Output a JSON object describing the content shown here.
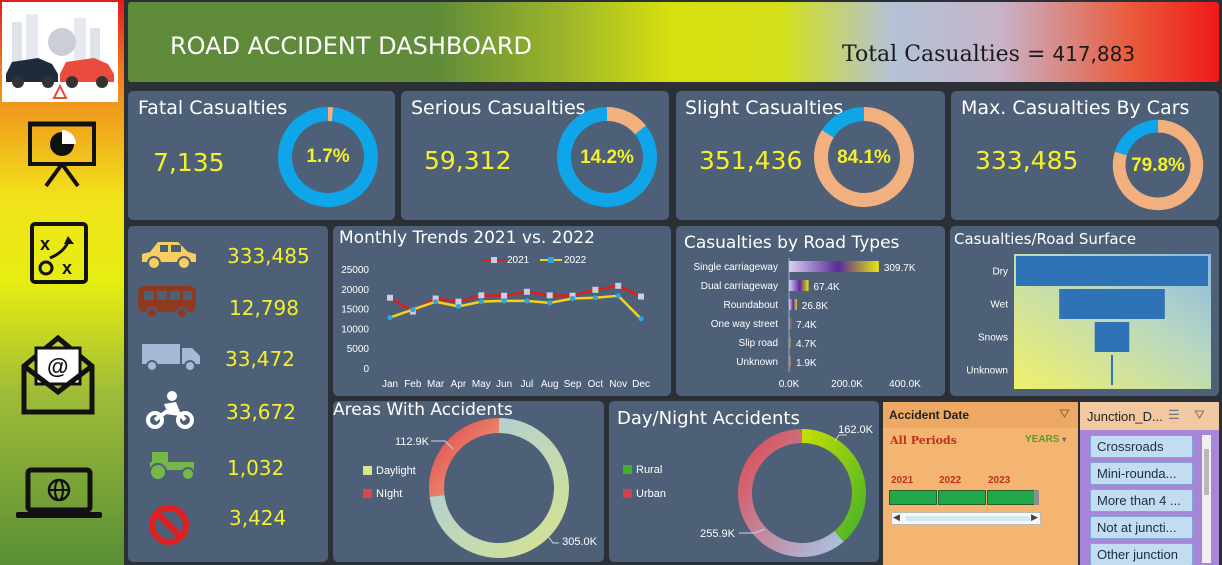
{
  "header": {
    "title": "ROAD ACCIDENT DASHBOARD",
    "total_label": "Total Casualties =",
    "total_value": "417,883"
  },
  "sidebar": {
    "icons": [
      "crash-logo-icon",
      "presentation-chart-icon",
      "strategy-board-icon",
      "email-icon",
      "laptop-globe-icon"
    ]
  },
  "kpis": [
    {
      "title": "Fatal Casualties",
      "value": "7,135",
      "pct_label": "1.7%",
      "pct": 0.017,
      "colors": [
        "#f3b07f",
        "#0fa5e9"
      ]
    },
    {
      "title": "Serious Casualties",
      "value": "59,312",
      "pct_label": "14.2%",
      "pct": 0.142,
      "colors": [
        "#f3b07f",
        "#0fa5e9"
      ]
    },
    {
      "title": "Slight Casualties",
      "value": "351,436",
      "pct_label": "84.1%",
      "pct": 0.841,
      "colors": [
        "#f3b07f",
        "#0fa5e9"
      ]
    },
    {
      "title": "Max. Casualties By Cars",
      "value": "333,485",
      "pct_label": "79.8%",
      "pct": 0.798,
      "colors": [
        "#f3b07f",
        "#0fa5e9"
      ]
    }
  ],
  "vehicles": [
    {
      "icon": "car-icon",
      "value": "333,485",
      "color": "#f7cf60"
    },
    {
      "icon": "bus-icon",
      "value": "12,798",
      "color": "#8c3b21"
    },
    {
      "icon": "truck-icon",
      "value": "33,472",
      "color": "#a8b9d8"
    },
    {
      "icon": "motorcycle-icon",
      "value": "33,672",
      "color": "#ffffff"
    },
    {
      "icon": "tractor-icon",
      "value": "1,032",
      "color": "#75b84a"
    },
    {
      "icon": "no-entry-icon",
      "value": "3,424",
      "color": "#e02020"
    }
  ],
  "chart_data": [
    {
      "type": "line",
      "title": "Monthly Trends 2021 vs. 2022",
      "categories": [
        "Jan",
        "Feb",
        "Mar",
        "Apr",
        "May",
        "Jun",
        "Jul",
        "Aug",
        "Sep",
        "Oct",
        "Nov",
        "Dec"
      ],
      "ylim": [
        0,
        25000
      ],
      "yticks": [
        "0",
        "5000",
        "10000",
        "15000",
        "20000",
        "25000"
      ],
      "series": [
        {
          "name": "2021",
          "color": "#e31b1b",
          "values": [
            18000,
            14500,
            17800,
            17000,
            18600,
            18500,
            19500,
            18600,
            18500,
            20000,
            21000,
            18300
          ]
        },
        {
          "name": "2022",
          "color": "#f5d21a",
          "values": [
            13000,
            15000,
            17000,
            15800,
            17000,
            17200,
            17200,
            16700,
            17800,
            18000,
            18500,
            12700
          ]
        }
      ]
    },
    {
      "type": "bar",
      "title": "Casualties by Road Types",
      "categories": [
        "Single carriageway",
        "Dual carriageway",
        "Roundabout",
        "One way street",
        "Slip road",
        "Unknown"
      ],
      "values": [
        309700,
        67400,
        26800,
        7400,
        4700,
        1900
      ],
      "data_labels": [
        "309.7K",
        "67.4K",
        "26.8K",
        "7.4K",
        "4.7K",
        "1.9K"
      ],
      "xticks": [
        "0.0K",
        "200.0K",
        "400.0K"
      ],
      "xlim": [
        0,
        400000
      ]
    },
    {
      "type": "bar",
      "title": "Casualties/Road Surface",
      "categories": [
        "Dry",
        "Wet",
        "Snows",
        "Unknown"
      ],
      "values": [
        1,
        0.55,
        0.18,
        0.01
      ]
    },
    {
      "type": "pie",
      "title": "Areas With Accidents",
      "categories": [
        "Daylight",
        "NIght"
      ],
      "values": [
        305000,
        112900
      ],
      "data_labels": [
        "305.0K",
        "112.9K"
      ],
      "colors": [
        "#d9e58a",
        "#e0414a"
      ]
    },
    {
      "type": "pie",
      "title": "Day/Night Accidents",
      "categories": [
        "Rural",
        "Urban"
      ],
      "values": [
        162000,
        255900
      ],
      "data_labels": [
        "162.0K",
        "255.9K"
      ],
      "colors": [
        "#40b02a",
        "#d24050"
      ]
    }
  ],
  "date_slicer": {
    "title": "Accident Date",
    "all_periods": "All Periods",
    "level": "YEARS",
    "years": [
      "2021",
      "2022",
      "2023"
    ]
  },
  "junction_slicer": {
    "title": "Junction_D...",
    "items": [
      "Crossroads",
      "Mini-rounda...",
      "More than 4 ...",
      "Not at juncti...",
      "Other junction"
    ]
  }
}
